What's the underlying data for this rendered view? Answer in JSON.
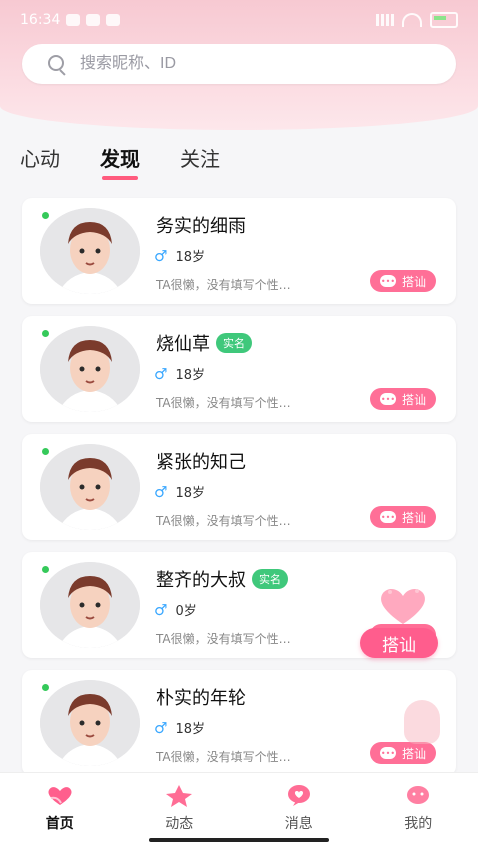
{
  "status_bar": {
    "time": "16:34"
  },
  "search": {
    "placeholder": "搜索昵称、ID"
  },
  "tabs": [
    {
      "label": "心动",
      "active": false
    },
    {
      "label": "发现",
      "active": true
    },
    {
      "label": "关注",
      "active": false
    }
  ],
  "users": [
    {
      "name": "务实的细雨",
      "age": "18岁",
      "bio": "TA很懒，没有填写个性…",
      "verified": false,
      "greet": "搭讪"
    },
    {
      "name": "烧仙草",
      "age": "18岁",
      "bio": "TA很懒，没有填写个性…",
      "verified": true,
      "verify_label": "实名",
      "greet": "搭讪"
    },
    {
      "name": "紧张的知己",
      "age": "18岁",
      "bio": "TA很懒，没有填写个性…",
      "verified": false,
      "greet": "搭讪"
    },
    {
      "name": "整齐的大叔",
      "age": "0岁",
      "bio": "TA很懒，没有填写个性…",
      "verified": true,
      "verify_label": "实名",
      "greet": "搭讪"
    },
    {
      "name": "朴实的年轮",
      "age": "18岁",
      "bio": "TA很懒，没有填写个性…",
      "verified": false,
      "greet": "搭讪"
    }
  ],
  "floating": {
    "greet_label": "搭讪"
  },
  "bottom_nav": [
    {
      "label": "首页",
      "icon": "heart-hands-icon",
      "active": true
    },
    {
      "label": "动态",
      "icon": "star-icon",
      "active": false
    },
    {
      "label": "消息",
      "icon": "chat-icon",
      "active": false
    },
    {
      "label": "我的",
      "icon": "profile-icon",
      "active": false
    }
  ],
  "colors": {
    "accent": "#ff5b7e",
    "verify": "#3fc87b",
    "male": "#39a7ff",
    "header_pink": "#f7c9d2"
  }
}
